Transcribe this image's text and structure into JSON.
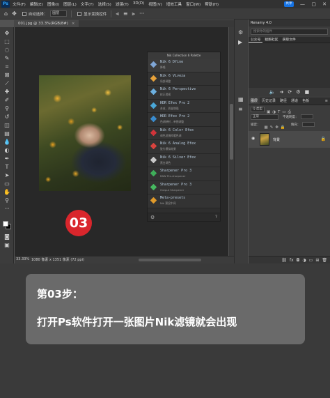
{
  "app": {
    "logo": "Ps",
    "menu": [
      "文件(F)",
      "编辑(E)",
      "图像(I)",
      "图层(L)",
      "文字(Y)",
      "选择(S)",
      "滤镜(T)",
      "3D(D)",
      "视图(V)",
      "增效工具",
      "窗口(W)",
      "帮助(H)"
    ],
    "share_label": "共享",
    "window_controls": [
      "—",
      "▢",
      "✕"
    ]
  },
  "options_bar": {
    "auto_select_label": "自动选择：",
    "auto_select_value": "图层",
    "transform_label": "显示变换控件"
  },
  "document": {
    "tab_label": "001.jpg @ 33.3%(RGB/8#)",
    "close_glyph": "×",
    "zoom": "33.33%",
    "info": "1080 像素 x 1351 像素 (72 ppi)"
  },
  "step_badge": "03",
  "nik_panel": {
    "title": "Nik Collection 6 Palette",
    "items": [
      {
        "name": "Nik 6 Dfine",
        "sub": "降噪",
        "color": "#7fa6d6"
      },
      {
        "name": "Nik 6 Viveza",
        "sub": "局部调整",
        "color": "#e8a23a"
      },
      {
        "name": "Nik 6 Perspective",
        "sub": "校正透视",
        "color": "#6cb0e0"
      },
      {
        "name": "HDR Efex Pro 2",
        "sub": "合成 - 质量增强",
        "color": "#4aa8d8"
      },
      {
        "name": "HDR Efex Pro 2",
        "sub": "色调映射 - 单图调整",
        "color": "#3a8ccf"
      },
      {
        "name": "Nik 6 Color Efex",
        "sub": "调色滤镜库暖色调",
        "color": "#d0343a"
      },
      {
        "name": "Nik 6 Analog Efex",
        "sub": "胶片模拟效果",
        "color": "#d8433e"
      },
      {
        "name": "Nik 6 Silver Efex",
        "sub": "黑白调色",
        "color": "#c8c8c8"
      },
      {
        "name": "Sharpener Pro 3",
        "sub": "RAW Pre-sharpener",
        "color": "#3fae5a"
      },
      {
        "name": "Sharpener Pro 3",
        "sub": "Output Sharpener",
        "color": "#46b860"
      },
      {
        "name": "Meta-presets",
        "sub": "Nik 预设中间",
        "color": "#e09a2a"
      }
    ]
  },
  "renamy": {
    "title": "Renamy 4.0",
    "search_placeholder": "搜索你的插件",
    "tabs": [
      "公众号",
      "聪跑社区",
      "获取文件"
    ]
  },
  "layers": {
    "tabs": [
      "图层",
      "历史记录",
      "路径",
      "通道",
      "色板"
    ],
    "kind_label": "Q 类型",
    "blend_mode": "正常",
    "opacity_label": "不透明度：",
    "lock_label": "锁定：",
    "fill_label": "填充：",
    "layer_name": "背景"
  },
  "caption": {
    "title": "第03步：",
    "text": "打开Ps软件打开一张图片Nik滤镜就会出现"
  }
}
